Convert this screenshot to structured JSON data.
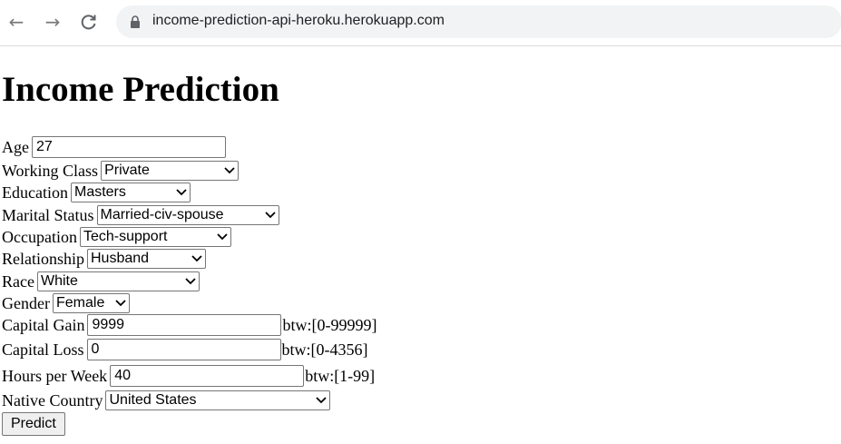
{
  "browser": {
    "url": "income-prediction-api-heroku.herokuapp.com"
  },
  "page": {
    "title": "Income Prediction",
    "fields": {
      "age": {
        "label": "Age",
        "value": "27"
      },
      "working_class": {
        "label": "Working Class",
        "value": "Private"
      },
      "education": {
        "label": "Education",
        "value": "Masters"
      },
      "marital_status": {
        "label": "Marital Status",
        "value": "Married-civ-spouse"
      },
      "occupation": {
        "label": "Occupation",
        "value": "Tech-support"
      },
      "relationship": {
        "label": "Relationship",
        "value": "Husband"
      },
      "race": {
        "label": "Race",
        "value": "White"
      },
      "gender": {
        "label": "Gender",
        "value": "Female"
      },
      "capital_gain": {
        "label": "Capital Gain",
        "value": "9999",
        "hint": "btw:[0-99999]"
      },
      "capital_loss": {
        "label": "Capital Loss",
        "value": "0",
        "hint": "btw:[0-4356]"
      },
      "hours_per_week": {
        "label": "Hours per Week",
        "value": "40",
        "hint": "btw:[1-99]"
      },
      "native_country": {
        "label": "Native Country",
        "value": "United States"
      }
    },
    "submit_label": "Predict"
  }
}
